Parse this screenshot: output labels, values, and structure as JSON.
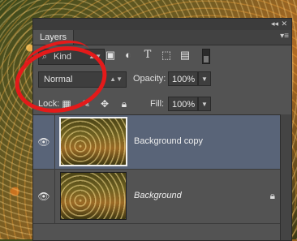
{
  "panel": {
    "tab_label": "Layers",
    "collapse_glyph": "◂◂",
    "close_glyph": "✕",
    "menu_glyph": "▾≡"
  },
  "filter": {
    "kind_label": "Kind",
    "icons": [
      "image-filter-icon",
      "adjustment-filter-icon",
      "type-filter-icon",
      "shape-filter-icon",
      "smart-object-filter-icon"
    ]
  },
  "blend": {
    "mode": "Normal",
    "opacity_label": "Opacity:",
    "opacity_value": "100%"
  },
  "lock": {
    "label": "Lock:",
    "fill_label": "Fill:",
    "fill_value": "100%"
  },
  "layers": [
    {
      "name": "Background copy",
      "selected": true,
      "visible": true,
      "locked": false
    },
    {
      "name": "Background",
      "selected": false,
      "visible": true,
      "locked": true
    }
  ],
  "colors": {
    "panel_bg": "#535353",
    "selected_row": "#596478",
    "annotation": "#e41a1a"
  }
}
